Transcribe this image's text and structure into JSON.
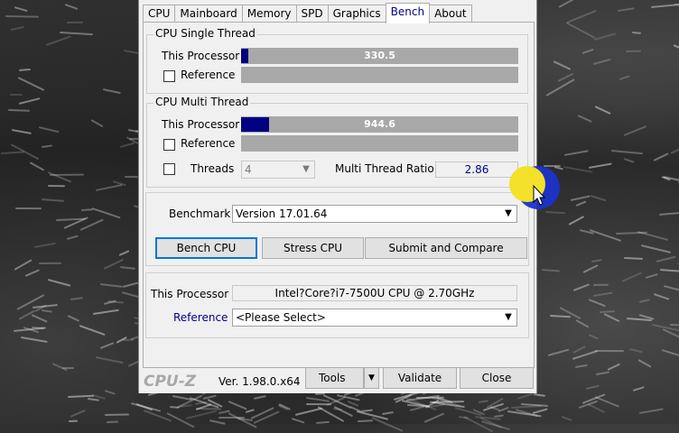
{
  "tabs": [
    "CPU",
    "Mainboard",
    "Memory",
    "SPD",
    "Graphics",
    "Bench",
    "About"
  ],
  "active_tab": "Bench",
  "single_thread": {
    "title": "CPU Single Thread",
    "this_processor_label": "This Processor",
    "this_processor_value": "330.5",
    "this_processor_fill": 0.025,
    "reference_label": "Reference"
  },
  "multi_thread": {
    "title": "CPU Multi Thread",
    "this_processor_label": "This Processor",
    "this_processor_value": "944.6",
    "this_processor_fill": 0.1,
    "reference_label": "Reference",
    "threads_label": "Threads",
    "threads_value": "4",
    "ratio_label": "Multi Thread Ratio",
    "ratio_value": "2.86"
  },
  "benchmark": {
    "label": "Benchmark",
    "version": "Version 17.01.64",
    "bench_cpu": "Bench CPU",
    "stress_cpu": "Stress CPU",
    "submit_compare": "Submit and Compare"
  },
  "processor": {
    "this_label": "This Processor",
    "this_value": "Intel?Core?i7-7500U CPU @ 2.70GHz",
    "reference_label": "Reference",
    "reference_value": "<Please Select>"
  },
  "footer": {
    "logo": "CPU-Z",
    "version": "Ver. 1.98.0.x64",
    "tools": "Tools",
    "validate": "Validate",
    "close": "Close"
  },
  "colors": {
    "accent": "#000080",
    "bar": "#a8a8a8",
    "cursor_highlight": "#f5e400"
  },
  "icons": [
    "chevron-down-icon",
    "mouse-pointer-icon"
  ]
}
